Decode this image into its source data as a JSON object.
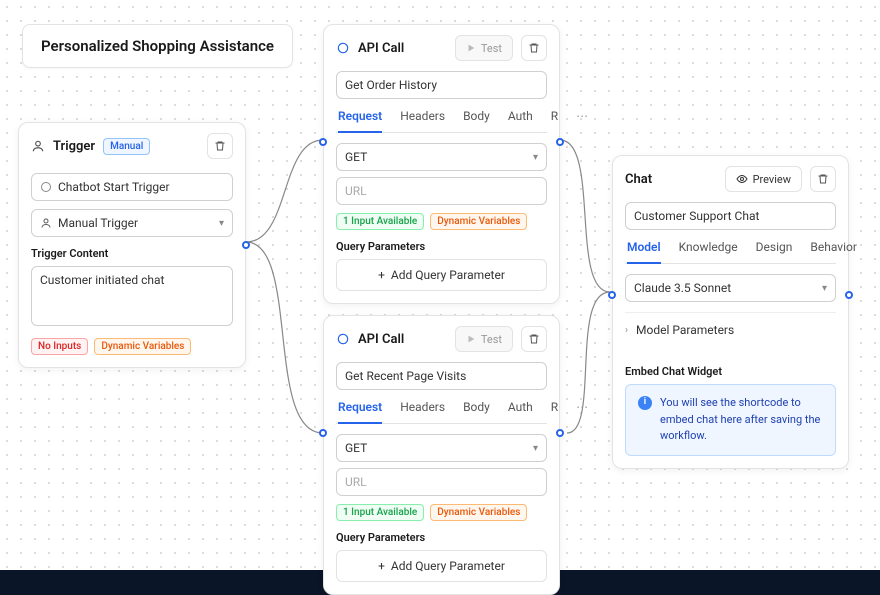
{
  "workflow_title": "Personalized Shopping Assistance",
  "trigger": {
    "title": "Trigger",
    "mode_badge": "Manual",
    "options": {
      "chatbot_start": "Chatbot Start Trigger",
      "manual": "Manual Trigger"
    },
    "content_label": "Trigger Content",
    "content_value": "Customer initiated chat",
    "no_inputs": "No Inputs",
    "dyn_vars": "Dynamic Variables"
  },
  "api1": {
    "title": "API Call",
    "test": "Test",
    "name": "Get Order History",
    "tabs": [
      "Request",
      "Headers",
      "Body",
      "Auth",
      "R"
    ],
    "method": "GET",
    "url_placeholder": "URL",
    "input_avail": "1 Input Available",
    "dyn_vars": "Dynamic Variables",
    "params_label": "Query Parameters",
    "add_param": "Add Query Parameter"
  },
  "api2": {
    "title": "API Call",
    "test": "Test",
    "name": "Get Recent Page Visits",
    "tabs": [
      "Request",
      "Headers",
      "Body",
      "Auth",
      "R"
    ],
    "method": "GET",
    "url_placeholder": "URL",
    "input_avail": "1 Input Available",
    "dyn_vars": "Dynamic Variables",
    "params_label": "Query Parameters",
    "add_param": "Add Query Parameter"
  },
  "chat": {
    "title": "Chat",
    "preview": "Preview",
    "name": "Customer Support Chat",
    "tabs": [
      "Model",
      "Knowledge",
      "Design",
      "Behavior"
    ],
    "model": "Claude 3.5 Sonnet",
    "model_params": "Model Parameters",
    "embed_label": "Embed Chat Widget",
    "embed_info": "You will see the shortcode to embed chat here after saving the workflow."
  }
}
